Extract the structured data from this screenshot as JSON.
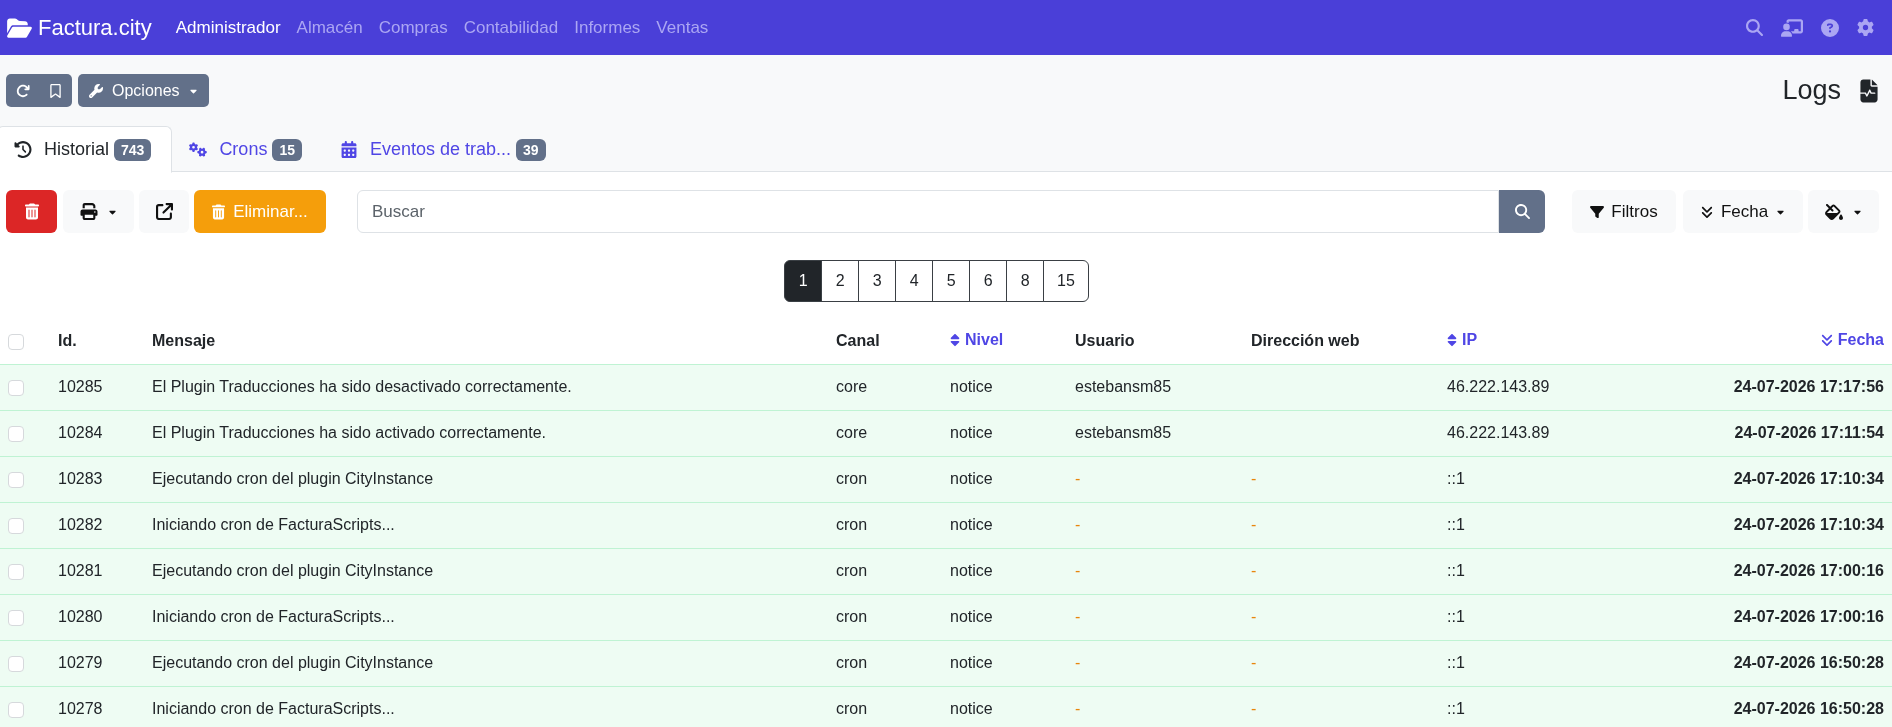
{
  "navbar": {
    "brand": "Factura.city",
    "menu": [
      {
        "label": "Administrador",
        "selected": true
      },
      {
        "label": "Almacén",
        "selected": false
      },
      {
        "label": "Compras",
        "selected": false
      },
      {
        "label": "Contabilidad",
        "selected": false
      },
      {
        "label": "Informes",
        "selected": false
      },
      {
        "label": "Ventas",
        "selected": false
      }
    ]
  },
  "toolbar": {
    "options_button": "Opciones"
  },
  "page_title": "Logs",
  "tabs": [
    {
      "label": "Historial",
      "count": "743",
      "selected": true
    },
    {
      "label": "Crons",
      "count": "15",
      "selected": false
    },
    {
      "label": "Eventos de trab...",
      "count": "39",
      "selected": false
    }
  ],
  "actions": {
    "delete_button": "Eliminar...",
    "search": {
      "placeholder": "Buscar"
    },
    "filters_button": "Filtros",
    "sort_button": "Fecha"
  },
  "pagination": [
    {
      "label": "1",
      "selected": true
    },
    {
      "label": "2",
      "selected": false
    },
    {
      "label": "3",
      "selected": false
    },
    {
      "label": "4",
      "selected": false
    },
    {
      "label": "5",
      "selected": false
    },
    {
      "label": "6",
      "selected": false
    },
    {
      "label": "8",
      "selected": false
    },
    {
      "label": "15",
      "selected": false
    }
  ],
  "table": {
    "header_checked": false,
    "columns": [
      {
        "label": "Id.",
        "sortable": false,
        "sorted": false
      },
      {
        "label": "Mensaje",
        "sortable": false,
        "sorted": false
      },
      {
        "label": "Canal",
        "sortable": false,
        "sorted": false
      },
      {
        "label": "Nivel",
        "sortable": true,
        "sorted": false
      },
      {
        "label": "Usuario",
        "sortable": false,
        "sorted": false
      },
      {
        "label": "Dirección web",
        "sortable": false,
        "sorted": false
      },
      {
        "label": "IP",
        "sortable": true,
        "sorted": false
      },
      {
        "label": "Fecha",
        "sortable": true,
        "sorted": true
      }
    ],
    "rows": [
      {
        "checked": false,
        "id": "10285",
        "message": "El Plugin Traducciones ha sido desactivado correctamente.",
        "channel": "core",
        "severity": "notice",
        "user": {
          "text": "estebansm85",
          "kind": "value"
        },
        "ip": "46.222.143.89",
        "date": "24-07-2026 17:17:56"
      },
      {
        "checked": false,
        "id": "10284",
        "message": "El Plugin Traducciones ha sido activado correctamente.",
        "channel": "core",
        "severity": "notice",
        "user": {
          "text": "estebansm85",
          "kind": "value"
        },
        "ip": "46.222.143.89",
        "date": "24-07-2026 17:11:54"
      },
      {
        "checked": false,
        "id": "10283",
        "message": "Ejecutando cron del plugin CityInstance",
        "channel": "cron",
        "severity": "notice",
        "user": {
          "text": "-",
          "kind": "placeholder"
        },
        "web_address": {
          "text": "-",
          "kind": "placeholder"
        },
        "ip": "::1",
        "date": "24-07-2026 17:10:34"
      },
      {
        "checked": false,
        "id": "10282",
        "message": "Iniciando cron de FacturaScripts...",
        "channel": "cron",
        "severity": "notice",
        "user": {
          "text": "-",
          "kind": "placeholder"
        },
        "web_address": {
          "text": "-",
          "kind": "placeholder"
        },
        "ip": "::1",
        "date": "24-07-2026 17:10:34"
      },
      {
        "checked": false,
        "id": "10281",
        "message": "Ejecutando cron del plugin CityInstance",
        "channel": "cron",
        "severity": "notice",
        "user": {
          "text": "-",
          "kind": "placeholder"
        },
        "web_address": {
          "text": "-",
          "kind": "placeholder"
        },
        "ip": "::1",
        "date": "24-07-2026 17:00:16"
      },
      {
        "checked": false,
        "id": "10280",
        "message": "Iniciando cron de FacturaScripts...",
        "channel": "cron",
        "severity": "notice",
        "user": {
          "text": "-",
          "kind": "placeholder"
        },
        "web_address": {
          "text": "-",
          "kind": "placeholder"
        },
        "ip": "::1",
        "date": "24-07-2026 17:00:16"
      },
      {
        "checked": false,
        "id": "10279",
        "message": "Ejecutando cron del plugin CityInstance",
        "channel": "cron",
        "severity": "notice",
        "user": {
          "text": "-",
          "kind": "placeholder"
        },
        "web_address": {
          "text": "-",
          "kind": "placeholder"
        },
        "ip": "::1",
        "date": "24-07-2026 16:50:28"
      },
      {
        "checked": false,
        "id": "10278",
        "message": "Iniciando cron de FacturaScripts...",
        "channel": "cron",
        "severity": "notice",
        "user": {
          "text": "-",
          "kind": "placeholder"
        },
        "web_address": {
          "text": "-",
          "kind": "placeholder"
        },
        "ip": "::1",
        "date": "24-07-2026 16:50:28"
      }
    ]
  }
}
